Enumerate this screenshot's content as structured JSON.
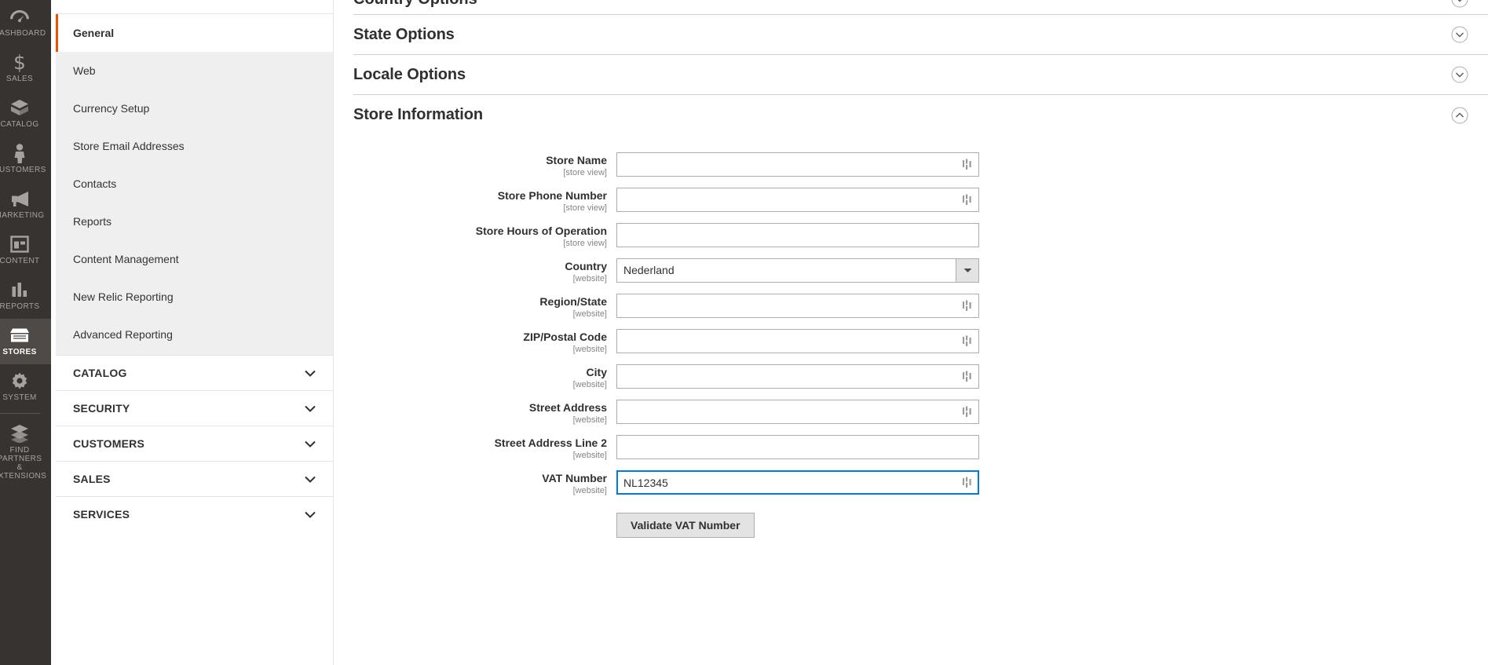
{
  "primary_nav": {
    "items": [
      {
        "label": "DASHBOARD",
        "icon": "dashboard-icon",
        "active": false
      },
      {
        "label": "SALES",
        "icon": "sales-dollar-icon",
        "active": false
      },
      {
        "label": "CATALOG",
        "icon": "catalog-box-icon",
        "active": false
      },
      {
        "label": "CUSTOMERS",
        "icon": "customers-person-icon",
        "active": false
      },
      {
        "label": "MARKETING",
        "icon": "marketing-megaphone-icon",
        "active": false
      },
      {
        "label": "CONTENT",
        "icon": "content-layout-icon",
        "active": false
      },
      {
        "label": "REPORTS",
        "icon": "reports-bars-icon",
        "active": false
      },
      {
        "label": "STORES",
        "icon": "stores-storefront-icon",
        "active": true
      },
      {
        "label": "SYSTEM",
        "icon": "system-gear-icon",
        "active": false
      },
      {
        "label": "FIND PARTNERS\n& EXTENSIONS",
        "icon": "extensions-boxes-icon",
        "active": false
      }
    ]
  },
  "secondary_nav": {
    "general_links": [
      {
        "label": "General",
        "active": true
      },
      {
        "label": "Web",
        "active": false
      },
      {
        "label": "Currency Setup",
        "active": false
      },
      {
        "label": "Store Email Addresses",
        "active": false
      },
      {
        "label": "Contacts",
        "active": false
      },
      {
        "label": "Reports",
        "active": false
      },
      {
        "label": "Content Management",
        "active": false
      },
      {
        "label": "New Relic Reporting",
        "active": false
      },
      {
        "label": "Advanced Reporting",
        "active": false
      }
    ],
    "sections": [
      {
        "label": "CATALOG",
        "expanded": false
      },
      {
        "label": "SECURITY",
        "expanded": false
      },
      {
        "label": "CUSTOMERS",
        "expanded": false
      },
      {
        "label": "SALES",
        "expanded": false
      },
      {
        "label": "SERVICES",
        "expanded": false
      }
    ]
  },
  "main": {
    "cut_off_section": {
      "title": "Country Options"
    },
    "accordions": [
      {
        "title": "State Options",
        "expanded": false
      },
      {
        "title": "Locale Options",
        "expanded": false
      },
      {
        "title": "Store Information",
        "expanded": true
      }
    ],
    "store_information": {
      "fields": [
        {
          "label": "Store Name",
          "scope": "[store view]",
          "value": "",
          "type": "text",
          "autofill": true,
          "focused": false
        },
        {
          "label": "Store Phone Number",
          "scope": "[store view]",
          "value": "",
          "type": "text",
          "autofill": true,
          "focused": false
        },
        {
          "label": "Store Hours of Operation",
          "scope": "[store view]",
          "value": "",
          "type": "text",
          "autofill": false,
          "focused": false
        },
        {
          "label": "Country",
          "scope": "[website]",
          "value": "Nederland",
          "type": "select",
          "autofill": false,
          "focused": false
        },
        {
          "label": "Region/State",
          "scope": "[website]",
          "value": "",
          "type": "text",
          "autofill": true,
          "focused": false
        },
        {
          "label": "ZIP/Postal Code",
          "scope": "[website]",
          "value": "",
          "type": "text",
          "autofill": true,
          "focused": false
        },
        {
          "label": "City",
          "scope": "[website]",
          "value": "",
          "type": "text",
          "autofill": true,
          "focused": false
        },
        {
          "label": "Street Address",
          "scope": "[website]",
          "value": "",
          "type": "text",
          "autofill": true,
          "focused": false
        },
        {
          "label": "Street Address Line 2",
          "scope": "[website]",
          "value": "",
          "type": "text",
          "autofill": false,
          "focused": false
        },
        {
          "label": "VAT Number",
          "scope": "[website]",
          "value": "NL12345",
          "type": "text",
          "autofill": true,
          "focused": true
        }
      ],
      "validate_button_label": "Validate VAT Number",
      "country_options": [
        "Nederland"
      ]
    }
  },
  "colors": {
    "accent_orange": "#eb5202",
    "nav_dark": "#373330",
    "nav_active": "#4f4a45",
    "focus_blue": "#007bdb",
    "text_dark": "#303030",
    "muted": "#858585"
  }
}
